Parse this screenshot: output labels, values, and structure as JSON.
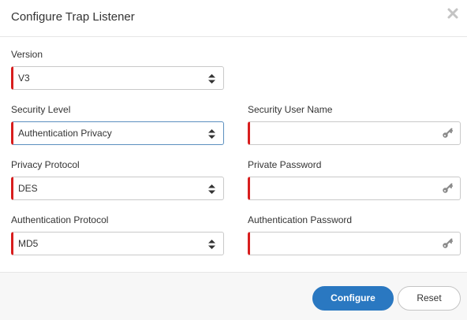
{
  "dialog": {
    "title": "Configure Trap Listener",
    "close_icon": "close-icon"
  },
  "form": {
    "version": {
      "label": "Version",
      "value": "V3"
    },
    "security_level": {
      "label": "Security Level",
      "value": "Authentication Privacy"
    },
    "security_user_name": {
      "label": "Security User Name",
      "value": "",
      "icon": "key-icon"
    },
    "privacy_protocol": {
      "label": "Privacy Protocol",
      "value": "DES"
    },
    "private_password": {
      "label": "Private Password",
      "value": "",
      "icon": "key-icon"
    },
    "authentication_protocol": {
      "label": "Authentication Protocol",
      "value": "MD5"
    },
    "authentication_password": {
      "label": "Authentication Password",
      "value": "",
      "icon": "key-icon"
    }
  },
  "footer": {
    "configure_label": "Configure",
    "reset_label": "Reset"
  },
  "colors": {
    "required_marker": "#d81e1e",
    "primary_button": "#2a78c1",
    "focus_border": "#5b8fbf"
  }
}
